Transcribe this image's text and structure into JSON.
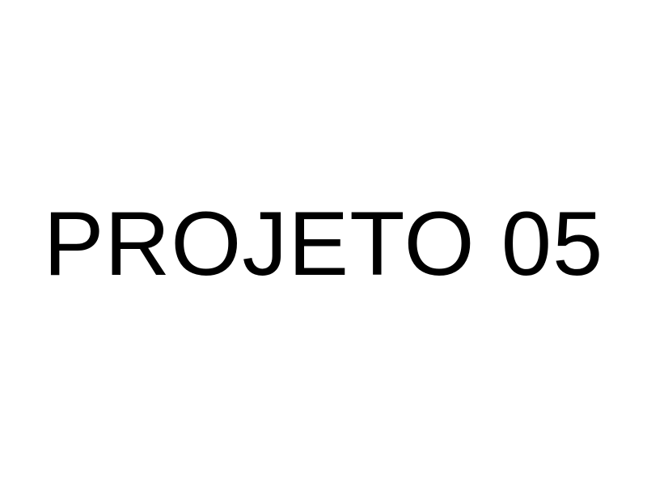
{
  "page": {
    "title": "PROJETO 05"
  }
}
